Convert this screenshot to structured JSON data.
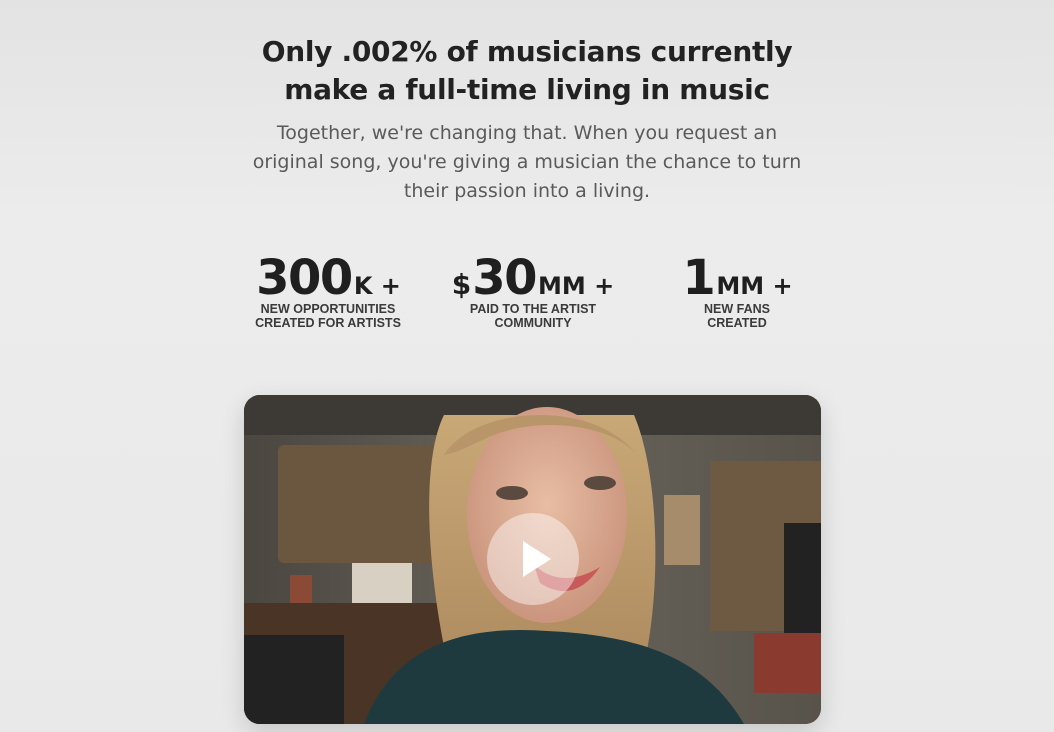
{
  "headline": {
    "line1": "Only .002% of musicians currently",
    "line2": "make a full-time living in music"
  },
  "subhead": {
    "line1": "Together, we're changing that. When you request an",
    "line2": "original song, you're giving a musician the chance to turn",
    "line3": "their passion into a living."
  },
  "stats": [
    {
      "prefix": "",
      "number": "300",
      "suffix": "K +",
      "label_line1": "NEW OPPORTUNITIES",
      "label_line2": "CREATED FOR ARTISTS"
    },
    {
      "prefix": "$",
      "number": "30",
      "suffix": "MM +",
      "label_line1": "PAID TO THE ARTIST",
      "label_line2": "COMMUNITY"
    },
    {
      "prefix": "",
      "number": "1",
      "suffix": "MM +",
      "label_line1": "NEW FANS",
      "label_line2": "CREATED"
    }
  ],
  "video": {
    "icon": "play-icon"
  }
}
